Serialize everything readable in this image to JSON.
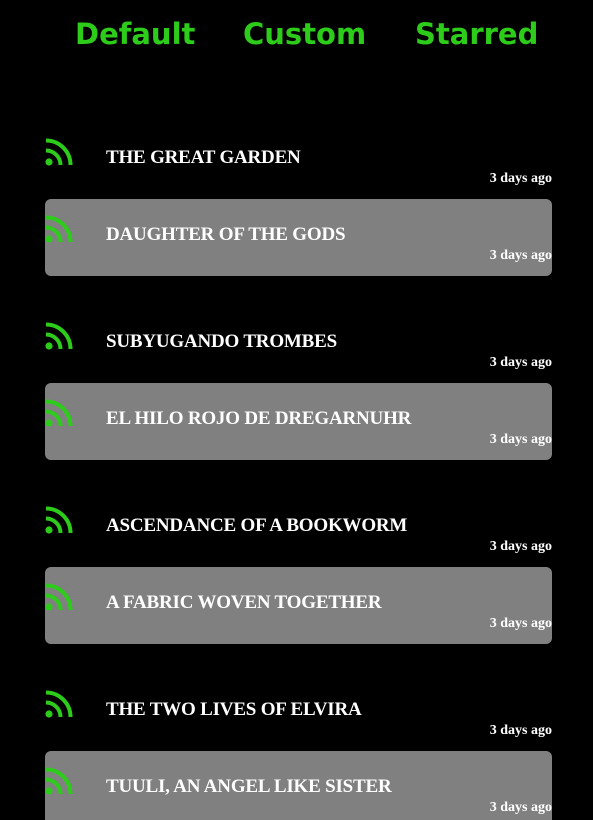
{
  "colors": {
    "background": "#000000",
    "accent": "#2ecc1a",
    "alt_row": "#808080",
    "text": "#ffffff"
  },
  "tabs": [
    {
      "label": "Default"
    },
    {
      "label": "Custom"
    },
    {
      "label": "Starred"
    }
  ],
  "feed": {
    "icon": "rss-icon",
    "items": [
      {
        "title": "THE GREAT GARDEN",
        "time": "3 days ago"
      },
      {
        "title": "DAUGHTER OF THE GODS",
        "time": "3 days ago"
      },
      {
        "title": "SUBYUGANDO TROMBES",
        "time": "3 days ago"
      },
      {
        "title": "EL HILO ROJO DE DREGARNUHR",
        "time": "3 days ago"
      },
      {
        "title": "ASCENDANCE OF A BOOKWORM",
        "time": "3 days ago"
      },
      {
        "title": "A FABRIC WOVEN TOGETHER",
        "time": "3 days ago"
      },
      {
        "title": "THE TWO LIVES OF ELVIRA",
        "time": "3 days ago"
      },
      {
        "title": "TUULI, AN ANGEL LIKE SISTER",
        "time": "3 days ago"
      }
    ]
  }
}
